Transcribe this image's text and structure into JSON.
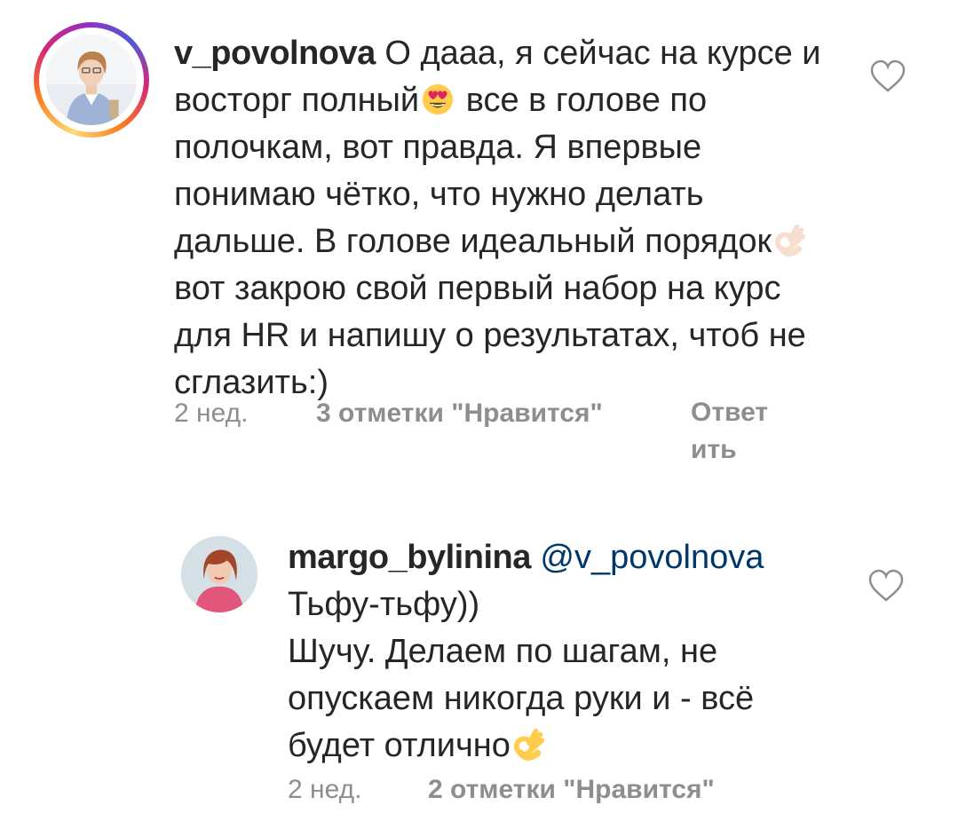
{
  "comments": [
    {
      "username": "v_povolnova",
      "text_part1": "О дааа, я сейчас на курсе и восторг полный",
      "emoji1": "heart-eyes-emoji",
      "text_part2": " все в голове по полочкам, вот правда. Я впервые понимаю чётко, что нужно делать дальше. В голове идеальный порядок",
      "emoji2": "ok-hand-emoji",
      "text_part3": " вот закрою свой первый набор на курс для HR и напишу о результатах, чтоб не сглазить:)",
      "time": "2 нед.",
      "likes": "3 отметки \"Нравится\"",
      "reply_line1": "Ответ",
      "reply_line2": "ить"
    },
    {
      "username": "margo_bylinina",
      "mention": "@v_povolnova",
      "text_line1": "Тьфу-тьфу))",
      "text_part2": "Шучу. Делаем по шагам, не опускаем никогда руки и - всё будет отлично",
      "emoji1": "ok-hand-emoji",
      "time": "2 нед.",
      "likes": "2 отметки \"Нравится\""
    }
  ],
  "colors": {
    "text": "#262626",
    "meta": "#8e8e8e",
    "mention": "#00376b"
  },
  "icons": {
    "like": "heart-outline-icon"
  }
}
